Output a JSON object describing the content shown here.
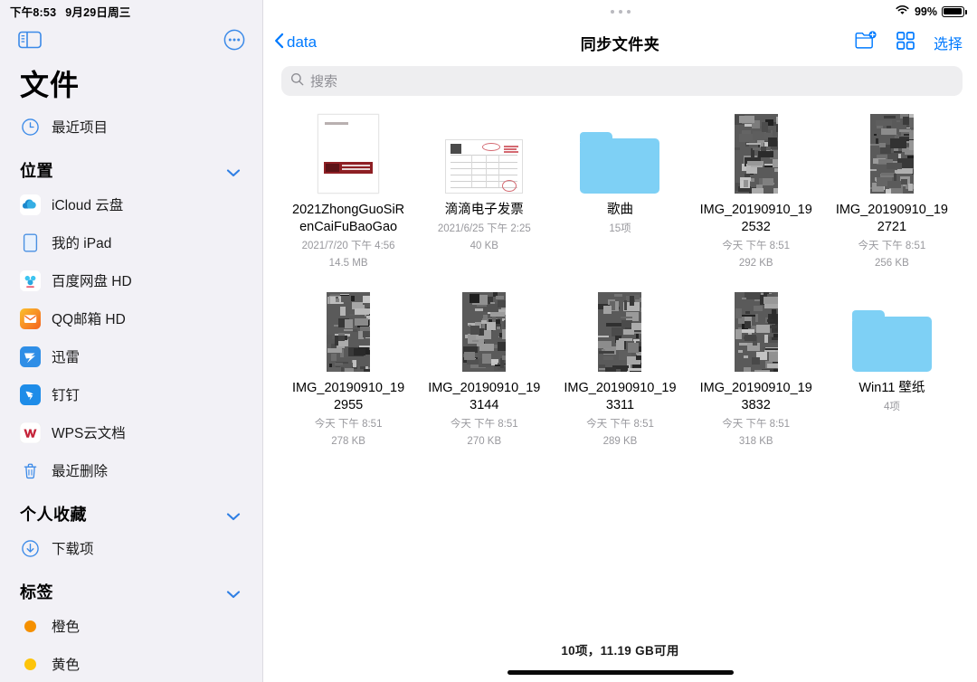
{
  "status_bar": {
    "time": "下午8:53",
    "date": "9月29日周三",
    "battery_percent": "99%",
    "wifi_icon": "wifi-icon",
    "battery_icon": "battery-full-icon"
  },
  "sidebar": {
    "toggle_icon": "sidebar-toggle-icon",
    "more_icon": "more-circle-icon",
    "title": "文件",
    "recents": {
      "label": "最近项目",
      "icon": "clock-icon"
    },
    "sections": [
      {
        "title": "位置",
        "chevron": "chevron-down-icon",
        "items": [
          {
            "label": "iCloud 云盘",
            "icon": "icloud-icon"
          },
          {
            "label": "我的 iPad",
            "icon": "ipad-icon"
          },
          {
            "label": "百度网盘 HD",
            "icon": "baidu-netdisk-icon"
          },
          {
            "label": "QQ邮箱 HD",
            "icon": "qq-mail-icon"
          },
          {
            "label": "迅雷",
            "icon": "xunlei-icon"
          },
          {
            "label": "钉钉",
            "icon": "dingtalk-icon"
          },
          {
            "label": "WPS云文档",
            "icon": "wps-icon"
          },
          {
            "label": "最近删除",
            "icon": "trash-icon"
          }
        ]
      },
      {
        "title": "个人收藏",
        "chevron": "chevron-down-icon",
        "items": [
          {
            "label": "下载项",
            "icon": "download-icon"
          }
        ]
      },
      {
        "title": "标签",
        "chevron": "chevron-down-icon",
        "items": [
          {
            "label": "橙色",
            "icon": "tag-dot-orange",
            "color": "#f59000"
          },
          {
            "label": "黄色",
            "icon": "tag-dot-yellow",
            "color": "#fdc40a"
          }
        ]
      }
    ]
  },
  "navbar": {
    "back_label": "data",
    "back_icon": "chevron-left-icon",
    "title": "同步文件夹",
    "new_folder_icon": "new-folder-icon",
    "grid_view_icon": "grid-view-icon",
    "select_label": "选择"
  },
  "search": {
    "placeholder": "搜索",
    "value": "",
    "icon": "search-icon"
  },
  "files": [
    {
      "name": "2021ZhongGuoSiRenCaiFuBaoGao",
      "date": "2021/7/20 下午 4:56",
      "size": "14.5 MB",
      "kind": "document"
    },
    {
      "name": "滴滴电子发票",
      "date": "2021/6/25 下午 2:25",
      "size": "40 KB",
      "kind": "invoice"
    },
    {
      "name": "歌曲",
      "date": "15项",
      "size": "",
      "kind": "folder"
    },
    {
      "name": "IMG_20190910_192532",
      "date": "今天 下午 8:51",
      "size": "292 KB",
      "kind": "photo",
      "seed": 1
    },
    {
      "name": "IMG_20190910_192721",
      "date": "今天 下午 8:51",
      "size": "256 KB",
      "kind": "photo",
      "seed": 2
    },
    {
      "name": "IMG_20190910_192955",
      "date": "今天 下午 8:51",
      "size": "278 KB",
      "kind": "photo",
      "seed": 3
    },
    {
      "name": "IMG_20190910_193144",
      "date": "今天 下午 8:51",
      "size": "270 KB",
      "kind": "photo",
      "seed": 4
    },
    {
      "name": "IMG_20190910_193311",
      "date": "今天 下午 8:51",
      "size": "289 KB",
      "kind": "photo",
      "seed": 5
    },
    {
      "name": "IMG_20190910_193832",
      "date": "今天 下午 8:51",
      "size": "318 KB",
      "kind": "photo",
      "seed": 6
    },
    {
      "name": "Win11 壁纸",
      "date": "4项",
      "size": "",
      "kind": "folder"
    }
  ],
  "footer": {
    "summary": "10项，11.19 GB可用"
  },
  "colors": {
    "accent": "#007aff",
    "sidebar_bg": "#f2f1f6",
    "folder_blue": "#7ed0f5",
    "secondary_text": "#98989d"
  }
}
